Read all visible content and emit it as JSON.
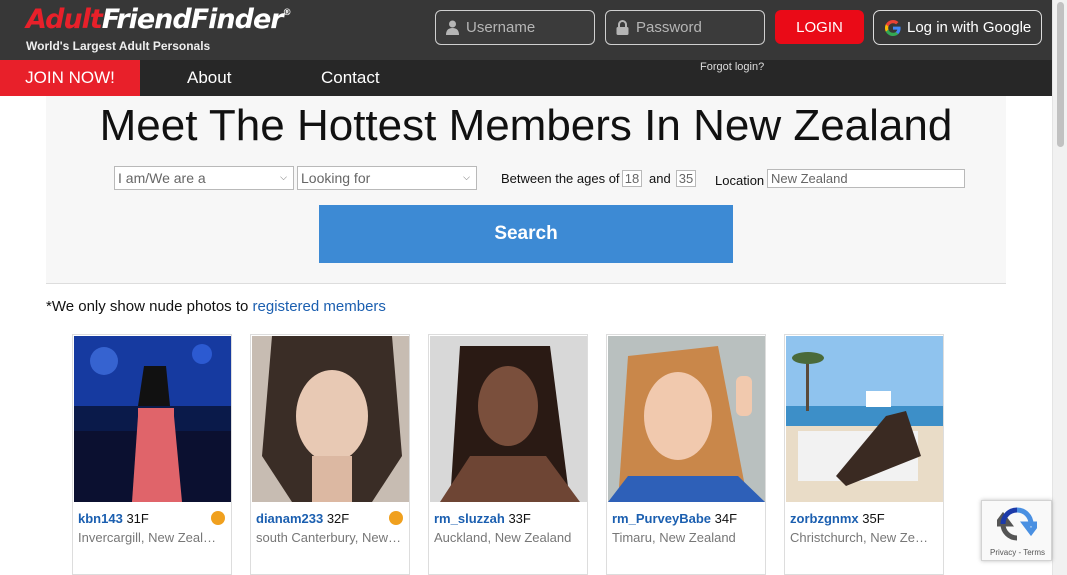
{
  "header": {
    "logo_part1": "Adult",
    "logo_part2": "FriendFinder",
    "logo_mark": "®",
    "tagline": "World's Largest Adult Personals",
    "username_placeholder": "Username",
    "password_placeholder": "Password",
    "login_label": "LOGIN",
    "google_label": "Log in with Google",
    "forgot_label": "Forgot login?",
    "icons": {
      "user": "user-icon",
      "lock": "lock-icon",
      "google": "google-icon"
    }
  },
  "nav": {
    "join_label": "JOIN NOW!",
    "items": [
      {
        "label": "About"
      },
      {
        "label": "Contact"
      }
    ]
  },
  "hero": {
    "headline": "Meet The Hottest Members In New Zealand",
    "iam_select": "I am/We are a",
    "looking_select": "Looking for",
    "age_label": "Between the ages of",
    "age_min": "18",
    "age_and": "and",
    "age_max": "35",
    "location_label": "Location",
    "location_value": "New Zealand",
    "search_label": "Search"
  },
  "notice": {
    "text": "*We only show nude photos to",
    "link": "registered members"
  },
  "members": [
    {
      "username": "kbn143",
      "age_gender": "31F",
      "location": "Invercargill, New Zealand",
      "crown": true
    },
    {
      "username": "dianam233",
      "age_gender": "32F",
      "location": "south Canterbury, New ...",
      "crown": true
    },
    {
      "username": "rm_sluzzah",
      "age_gender": "33F",
      "location": "Auckland, New Zealand",
      "crown": false
    },
    {
      "username": "rm_PurveyBabe",
      "age_gender": "34F",
      "location": "Timaru, New Zealand",
      "crown": false
    },
    {
      "username": "zorbzgnmx",
      "age_gender": "35F",
      "location": "Christchurch, New Zeala...",
      "crown": false
    }
  ],
  "recaptcha": {
    "text": "Privacy - Terms"
  },
  "colors": {
    "brand_red": "#e8202a",
    "search_blue": "#3d8ad4",
    "link_blue": "#1b5fb0",
    "topbar": "#373737"
  }
}
